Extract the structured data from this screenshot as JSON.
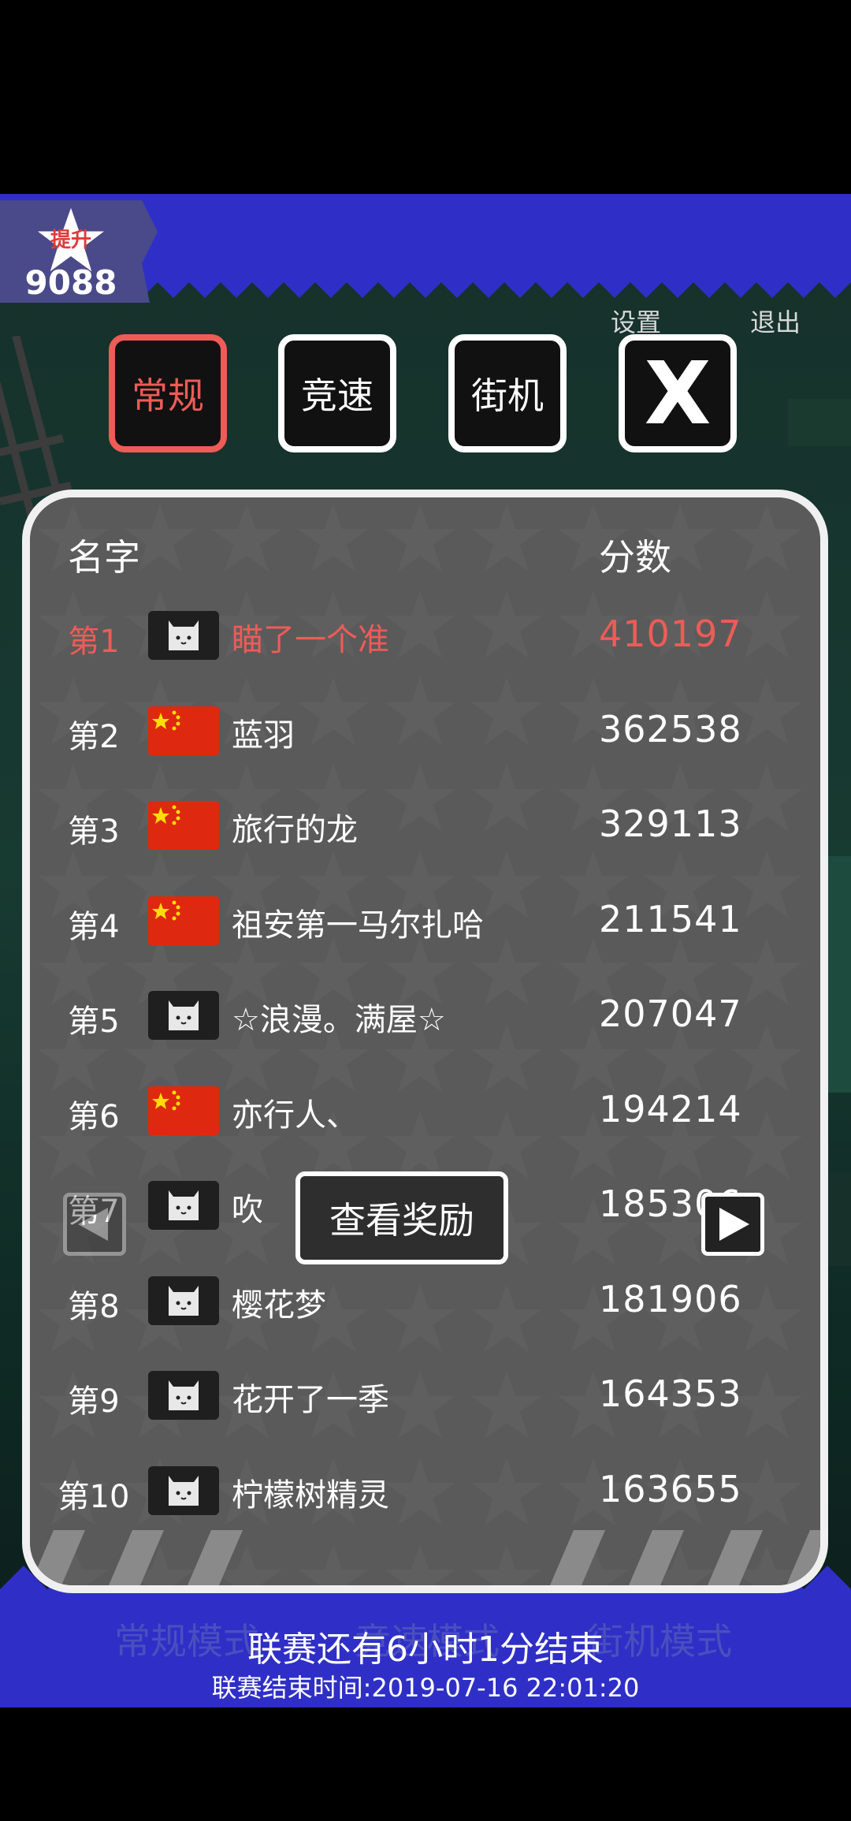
{
  "header": {
    "star_label": "提升",
    "star_value": "9088",
    "settings_label": "设置",
    "exit_label": "退出"
  },
  "tabs": [
    {
      "label": "常规",
      "active": true
    },
    {
      "label": "竞速",
      "active": false
    },
    {
      "label": "街机",
      "active": false
    }
  ],
  "close_label": "X",
  "leaderboard": {
    "col_name": "名字",
    "col_score": "分数",
    "rows": [
      {
        "rank": "第1",
        "avatar": "cat-icon",
        "name": "瞄了一个准",
        "score": "410197"
      },
      {
        "rank": "第2",
        "avatar": "china-flag-icon",
        "name": "蓝羽",
        "score": "362538"
      },
      {
        "rank": "第3",
        "avatar": "china-flag-icon",
        "name": "旅行的龙",
        "score": "329113"
      },
      {
        "rank": "第4",
        "avatar": "china-flag-icon",
        "name": "祖安第一马尔扎哈",
        "score": "211541"
      },
      {
        "rank": "第5",
        "avatar": "cat-icon",
        "name": "☆浪漫。满屋☆",
        "score": "207047"
      },
      {
        "rank": "第6",
        "avatar": "china-flag-icon",
        "name": "亦行人、",
        "score": "194214"
      },
      {
        "rank": "第7",
        "avatar": "cat-icon",
        "name": "吹",
        "score": "185306"
      },
      {
        "rank": "第8",
        "avatar": "cat-icon",
        "name": "樱花梦",
        "score": "181906"
      },
      {
        "rank": "第9",
        "avatar": "cat-icon",
        "name": "花开了一季",
        "score": "164353"
      },
      {
        "rank": "第10",
        "avatar": "cat-icon",
        "name": "柠檬树精灵",
        "score": "163655"
      }
    ]
  },
  "rewards_label": "查看奖励",
  "footer": {
    "modes": [
      "常规模式",
      "竞速模式",
      "街机模式"
    ],
    "league_message": "联赛还有6小时1分结束",
    "league_end": "联赛结束时间:2019-07-16 22:01:20"
  },
  "colors": {
    "accent": "#ef5b57",
    "banner_blue": "#2f2fc7",
    "panel_bg": "#5a5a5a"
  }
}
